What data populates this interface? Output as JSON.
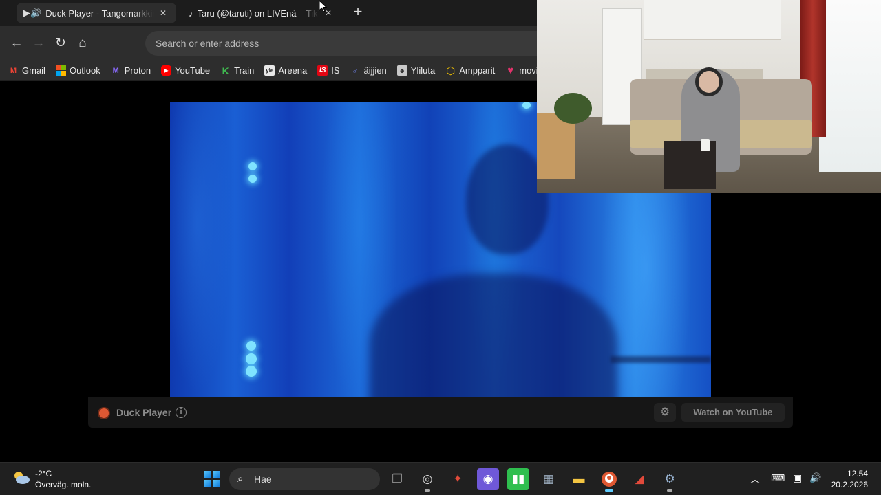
{
  "browser": {
    "tabs": [
      {
        "label": "Duck Player - Tangomarkkinat",
        "icon": "youtube-speaker-icon",
        "active": true
      },
      {
        "label": "Taru (@taruti) on LIVEnä – TikTok",
        "icon": "tiktok-icon",
        "active": false
      }
    ],
    "address_placeholder": "Search or enter address",
    "bookmarks": [
      {
        "label": "Gmail",
        "icon": "gmail-icon",
        "color": "#ea4335"
      },
      {
        "label": "Outlook",
        "icon": "outlook-icon",
        "color": "#0078d4"
      },
      {
        "label": "Proton",
        "icon": "proton-icon",
        "color": "#6d4aff"
      },
      {
        "label": "YouTube",
        "icon": "youtube-icon",
        "color": "#ff0000"
      },
      {
        "label": "Train",
        "icon": "train-icon",
        "color": "#3fb950"
      },
      {
        "label": "Areena",
        "icon": "areena-icon",
        "color": "#e8e8e8"
      },
      {
        "label": "IS",
        "icon": "is-icon",
        "color": "#e30613"
      },
      {
        "label": "äijjien",
        "icon": "aijjien-icon",
        "color": "#6a7bd8"
      },
      {
        "label": "Yliluta",
        "icon": "ylilauta-icon",
        "color": "#c9c9c9"
      },
      {
        "label": "Ampparit",
        "icon": "ampparit-icon",
        "color": "#f5c400"
      },
      {
        "label": "movies",
        "icon": "heart-icon",
        "color": "#e2336b"
      }
    ]
  },
  "duck_player": {
    "name": "Duck Player",
    "watch_label": "Watch on YouTube"
  },
  "taskbar": {
    "weather_temp": "-2°C",
    "weather_desc": "Överväg. moln.",
    "search_label": "Hae",
    "time": "12.54",
    "date": "20.2.2026"
  },
  "colors": {
    "accent": "#60cdff",
    "duck_orange": "#de5833",
    "video_blue": "#1a5fd4"
  }
}
